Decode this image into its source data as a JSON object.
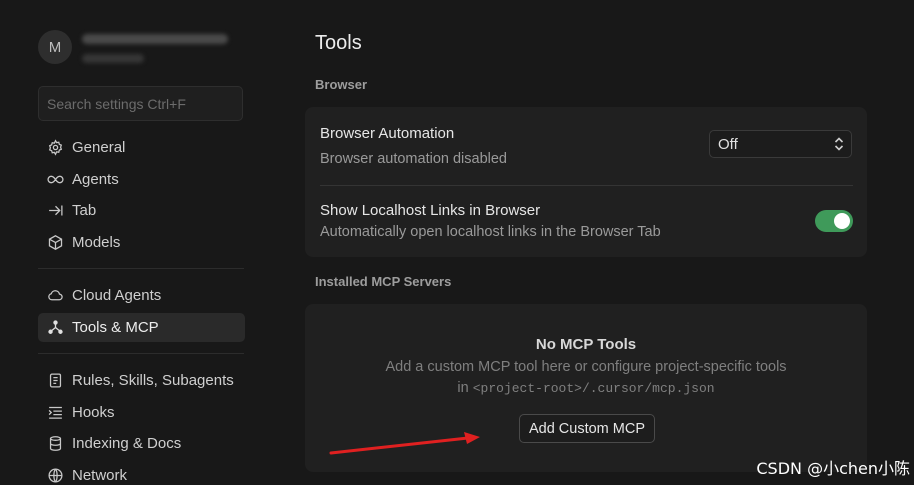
{
  "sidebar": {
    "avatar_initial": "M",
    "search_placeholder": "Search settings Ctrl+F",
    "group1": [
      {
        "label": "General",
        "icon": "gear-icon"
      },
      {
        "label": "Agents",
        "icon": "infinity-icon"
      },
      {
        "label": "Tab",
        "icon": "tab-arrow-icon"
      },
      {
        "label": "Models",
        "icon": "cube-icon"
      }
    ],
    "group2": [
      {
        "label": "Cloud Agents",
        "icon": "cloud-icon"
      },
      {
        "label": "Tools & MCP",
        "icon": "tools-icon",
        "active": true
      }
    ],
    "group3": [
      {
        "label": "Rules, Skills, Subagents",
        "icon": "document-icon"
      },
      {
        "label": "Hooks",
        "icon": "hooks-icon"
      },
      {
        "label": "Indexing & Docs",
        "icon": "database-icon"
      },
      {
        "label": "Network",
        "icon": "globe-icon"
      }
    ]
  },
  "main": {
    "title": "Tools",
    "browser_section_label": "Browser",
    "browser_automation": {
      "title": "Browser Automation",
      "description": "Browser automation disabled",
      "select_value": "Off"
    },
    "localhost_links": {
      "title": "Show Localhost Links in Browser",
      "description": "Automatically open localhost links in the Browser Tab",
      "enabled": true
    },
    "mcp_section_label": "Installed MCP Servers",
    "mcp_empty": {
      "title": "No MCP Tools",
      "line1": "Add a custom MCP tool here or configure project-specific tools",
      "line2_prefix": "in",
      "line2_path": "<project-root>/.cursor/mcp.json",
      "button_label": "Add Custom MCP"
    }
  },
  "watermark": "CSDN @小chen小陈",
  "colors": {
    "background": "#181818",
    "card": "#202020",
    "toggle_on": "#3f9a5a",
    "annotation_arrow": "#e02020"
  }
}
